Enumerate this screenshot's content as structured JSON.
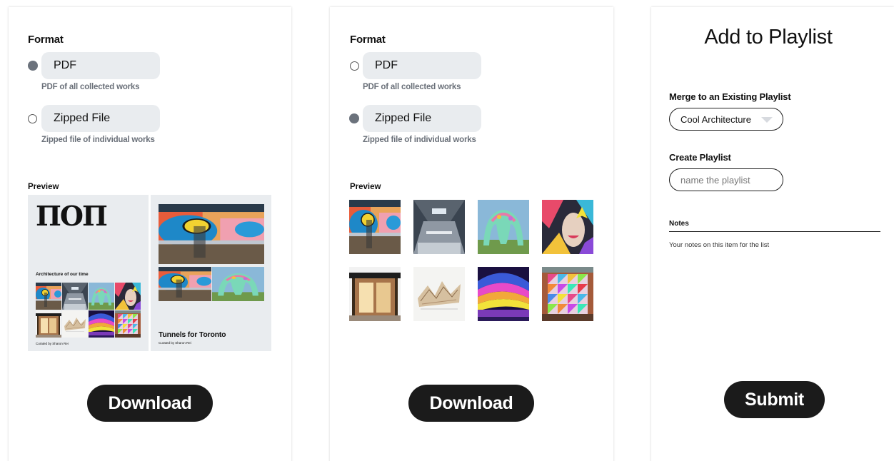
{
  "download_panel_1": {
    "format_title": "Format",
    "options": [
      {
        "label": "PDF",
        "description": "PDF of all collected works",
        "selected": true
      },
      {
        "label": "Zipped File",
        "description": "Zipped file of individual works",
        "selected": false
      }
    ],
    "preview_title": "Preview",
    "pdf_preview": {
      "logo_text": "ΠOΠ",
      "page1_heading": "Architecture of our time",
      "page1_curator": "Curated by Sharon Rei",
      "page2_heading": "Tunnels for Toronto",
      "page2_curator": "Curated by Sharon Rei"
    },
    "download_label": "Download"
  },
  "download_panel_2": {
    "format_title": "Format",
    "options": [
      {
        "label": "PDF",
        "description": "PDF of all collected works",
        "selected": false
      },
      {
        "label": "Zipped File",
        "description": "Zipped file of individual works",
        "selected": true
      }
    ],
    "preview_title": "Preview",
    "download_label": "Download"
  },
  "playlist_panel": {
    "title": "Add to Playlist",
    "merge_label": "Merge to an Existing Playlist",
    "merge_selected": "Cool Architecture",
    "create_label": "Create Playlist",
    "create_placeholder": "name the playlist",
    "notes_label": "Notes",
    "notes_text": "Your notes on this item for the list",
    "submit_label": "Submit"
  },
  "colors": {
    "button_bg": "#1b1b1b",
    "option_bg": "#e9ecef",
    "radio_selected": "#6b727c",
    "description_text": "#6a7079"
  }
}
